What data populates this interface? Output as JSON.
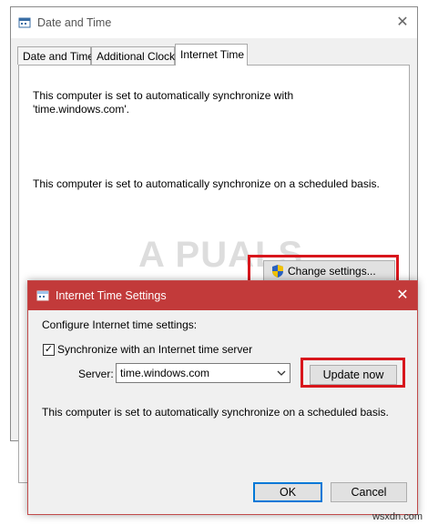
{
  "back_window": {
    "title": "Date and Time",
    "tabs": [
      {
        "label": "Date and Time",
        "active": false
      },
      {
        "label": "Additional Clocks",
        "active": false
      },
      {
        "label": "Internet Time",
        "active": true
      }
    ],
    "sync_line1": "This computer is set to automatically synchronize with",
    "sync_line2": "'time.windows.com'.",
    "schedule_text": "This computer is set to automatically synchronize on a scheduled basis.",
    "change_settings_label": "Change settings..."
  },
  "watermark": "A  PUALS",
  "dialog": {
    "title": "Internet Time Settings",
    "heading": "Configure Internet time settings:",
    "sync_checkbox_label": "Synchronize with an Internet time server",
    "sync_checked": true,
    "server_label": "Server:",
    "server_value": "time.windows.com",
    "update_now_label": "Update now",
    "schedule_text": "This computer is set to automatically synchronize on a scheduled basis.",
    "ok_label": "OK",
    "cancel_label": "Cancel"
  },
  "site_credit": "wsxdn.com",
  "colors": {
    "dialog_titlebar": "#c23a3a",
    "highlight_box": "#d8161c",
    "button_face": "#e1e1e1",
    "default_button_border": "#0078d7"
  },
  "icons": {
    "app": "date-time-icon",
    "shield": "uac-shield-icon",
    "close": "close-icon",
    "dropdown": "chevron-down-icon"
  }
}
